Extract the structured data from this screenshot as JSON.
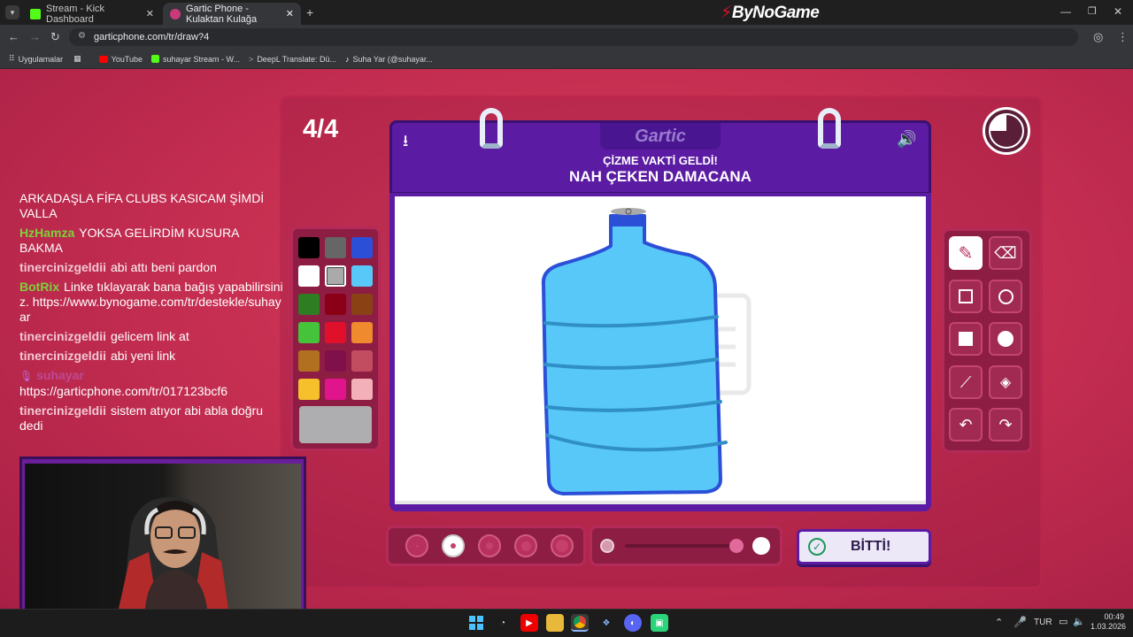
{
  "browser": {
    "tabs": [
      {
        "label": "Stream - Kick Dashboard",
        "active": false
      },
      {
        "label": "Gartic Phone - Kulaktan Kulağa",
        "active": true
      }
    ],
    "new_tab": "+",
    "brand": "ByNoGame",
    "url": "garticphone.com/tr/draw?4",
    "bookmarks": [
      "Uygulamalar",
      "YouTube",
      "suhayar Stream - W...",
      "DeepL Translate: Dü...",
      "Suha Yar (@suhayar..."
    ]
  },
  "game": {
    "round": "4/4",
    "logo": "Gartic",
    "subtitle": "ÇİZME VAKTİ GELDİ!",
    "prompt": "NAH ÇEKEN DAMACANA",
    "done_label": "BİTTİ!",
    "palette": [
      "#000000",
      "#666666",
      "#2c4fd8",
      "#ffffff",
      "#aaaaaa",
      "#58c8f8",
      "#2e7d22",
      "#8b0016",
      "#8a4214",
      "#45c33a",
      "#e0102a",
      "#f08a2e",
      "#b07020",
      "#80104a",
      "#c24c60",
      "#f5c02c",
      "#e0148c",
      "#f4b0b8"
    ],
    "selected_color": "#aeaeb0",
    "brush_sizes": 5,
    "selected_size_index": 1,
    "selected_tool": "pencil"
  },
  "chat": [
    {
      "user": "",
      "color": "#ffffff",
      "text": "ARKADAŞLA FİFA CLUBS KASICAM ŞİMDİ VALLA"
    },
    {
      "user": "HzHamza",
      "color": "#7dd23a",
      "text": "YOKSA GELİRDİM KUSURA BAKMA"
    },
    {
      "user": "tinercinizgeldii",
      "color": "#f2c6d2",
      "text": "abi attı beni pardon"
    },
    {
      "user": "BotRix",
      "color": "#7dd23a",
      "text": "Linke tıklayarak bana bağış yapabilirsiniz. https://www.bynogame.com/tr/destekle/suhayar"
    },
    {
      "user": "tinercinizgeldii",
      "color": "#f2c6d2",
      "text": "gelicem link at"
    },
    {
      "user": "tinercinizgeldii",
      "color": "#f2c6d2",
      "text": "abi yeni link"
    },
    {
      "user": "suhayar",
      "color": "#c06ad8",
      "text": "https://garticphone.com/tr/017123bcf6"
    },
    {
      "user": "tinercinizgeldii",
      "color": "#f2c6d2",
      "text": "sistem atıyor abi abla doğru dedi"
    }
  ],
  "taskbar": {
    "lang": "TUR",
    "time": "00:49",
    "date": "1.03.2026"
  }
}
